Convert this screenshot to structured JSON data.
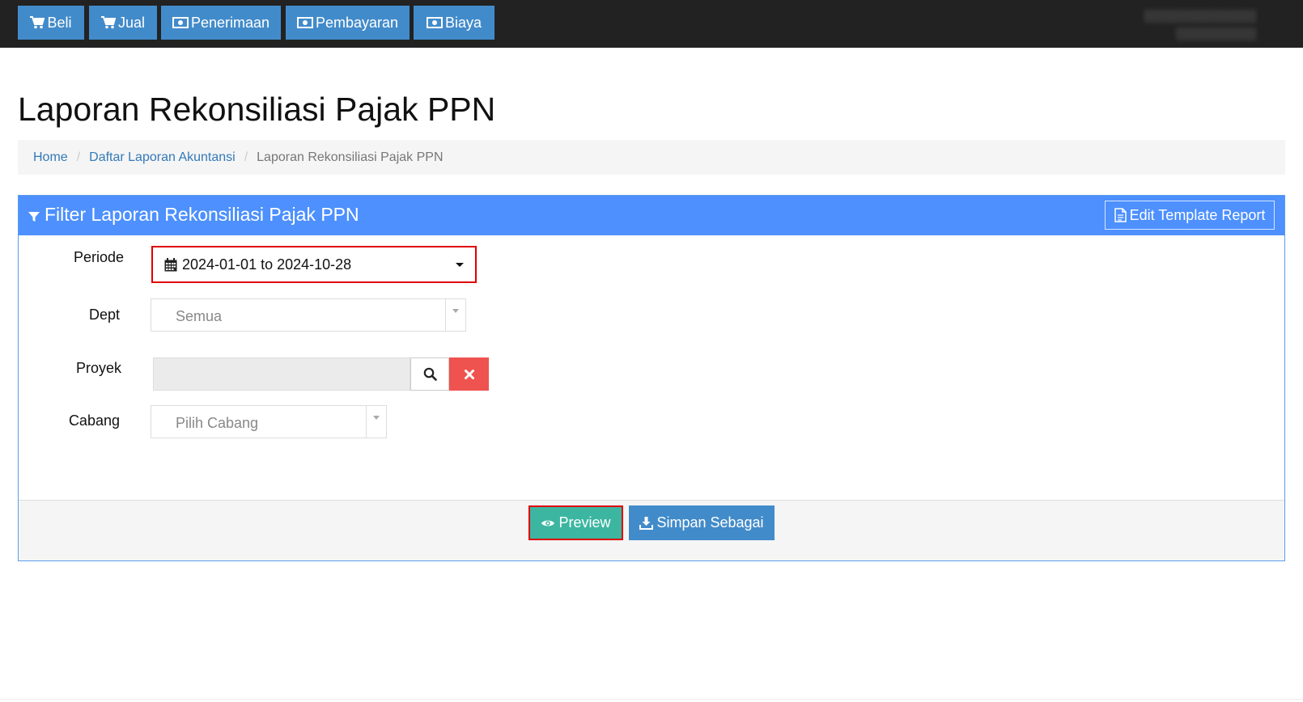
{
  "topnav": {
    "items": [
      {
        "label": "Beli",
        "icon": "cart-icon"
      },
      {
        "label": "Jual",
        "icon": "cart-icon"
      },
      {
        "label": "Penerimaan",
        "icon": "money-icon"
      },
      {
        "label": "Pembayaran",
        "icon": "money-icon"
      },
      {
        "label": "Biaya",
        "icon": "money-icon"
      }
    ],
    "background": "#222222",
    "button_color": "#428bca"
  },
  "page": {
    "title": "Laporan Rekonsiliasi Pajak PPN"
  },
  "breadcrumb": {
    "items": [
      "Home",
      "Daftar Laporan Akuntansi"
    ],
    "active": "Laporan Rekonsiliasi Pajak PPN"
  },
  "filter_panel": {
    "title": "Filter Laporan Rekonsiliasi Pajak PPN",
    "edit_template_label": "Edit Template Report",
    "header_color": "#4d90fe",
    "fields": {
      "periode": {
        "label": "Periode",
        "value": "2024-01-01 to 2024-10-28"
      },
      "dept": {
        "label": "Dept",
        "value": "Semua"
      },
      "proyek": {
        "label": "Proyek",
        "value": ""
      },
      "cabang": {
        "label": "Cabang",
        "placeholder": "Pilih Cabang"
      }
    },
    "buttons": {
      "preview": "Preview",
      "save_as": "Simpan Sebagai"
    },
    "highlight_color": "#e00000"
  }
}
